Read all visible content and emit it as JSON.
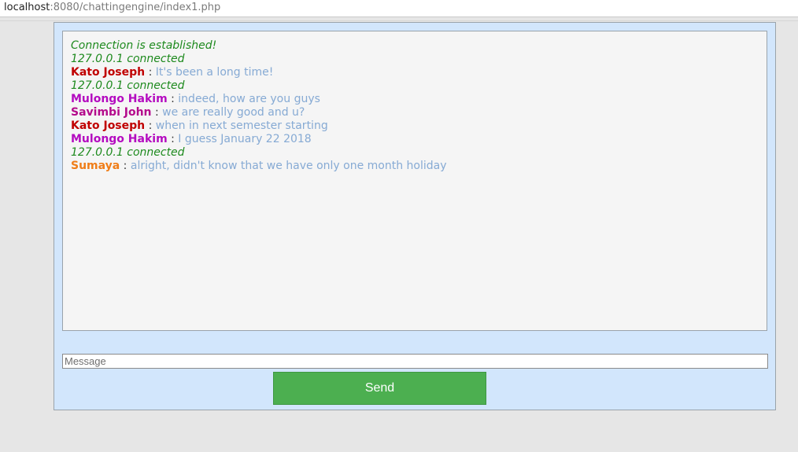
{
  "browser": {
    "url_host": "localhost",
    "url_rest": ":8080/chattingengine/index1.php"
  },
  "colors": {
    "system_text": "#1e8a1e",
    "message_text": "#86aad4",
    "container_bg": "#d2e6fc",
    "send_button_bg": "#4caf50"
  },
  "messages": [
    {
      "type": "system",
      "text": "Connection is established!"
    },
    {
      "type": "system",
      "text": "127.0.0.1 connected"
    },
    {
      "type": "chat",
      "user": "Kato Joseph",
      "sep": " : ",
      "text": "It's been a long time!",
      "user_color": "#c00000"
    },
    {
      "type": "system",
      "text": "127.0.0.1 connected"
    },
    {
      "type": "chat",
      "user": "Mulongo Hakim",
      "sep": " : ",
      "text": "indeed, how are you guys",
      "user_color": "#b40bc0"
    },
    {
      "type": "chat",
      "user": "Savimbi John",
      "sep": " : ",
      "text": "we are really good and u?",
      "user_color": "#b40b8c"
    },
    {
      "type": "chat",
      "user": "Kato Joseph",
      "sep": " : ",
      "text": "when in next semester starting",
      "user_color": "#c00000"
    },
    {
      "type": "chat",
      "user": "Mulongo Hakim",
      "sep": " : ",
      "text": "I guess January 22 2018",
      "user_color": "#b40bc0"
    },
    {
      "type": "system",
      "text": "127.0.0.1 connected"
    },
    {
      "type": "chat",
      "user": "Sumaya",
      "sep": " : ",
      "text": "alright, didn't know that we have only one month holiday",
      "user_color": "#f07d18"
    }
  ],
  "input": {
    "placeholder": "Message",
    "value": ""
  },
  "send_button": {
    "label": "Send"
  }
}
